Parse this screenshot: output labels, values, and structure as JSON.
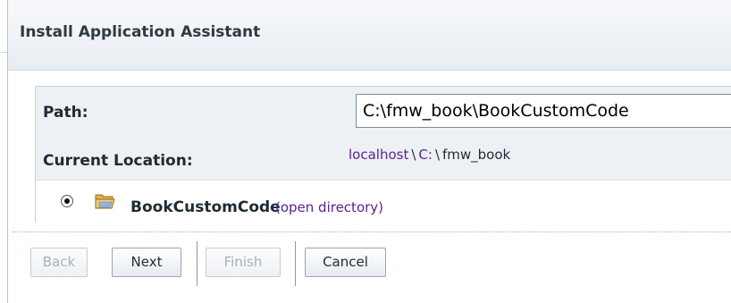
{
  "window": {
    "title": "Install Application Assistant"
  },
  "form": {
    "path_label": "Path:",
    "path_value": "C:\\fmw_book\\BookCustomCode",
    "current_location_label": "Current Location:",
    "breadcrumb": {
      "host": "localhost",
      "drive": "C:",
      "folder": "fmw_book",
      "separator": "\\"
    }
  },
  "directory": {
    "name": "BookCustomCode",
    "action_label": "(open directory)",
    "selected": true,
    "icon": "folder-open-icon"
  },
  "buttons": {
    "back": "Back",
    "next": "Next",
    "finish": "Finish",
    "cancel": "Cancel"
  },
  "colors": {
    "link": "#5a1f8f",
    "disabled_text": "#a7b0b9",
    "panel_bg": "#eef1f4"
  }
}
